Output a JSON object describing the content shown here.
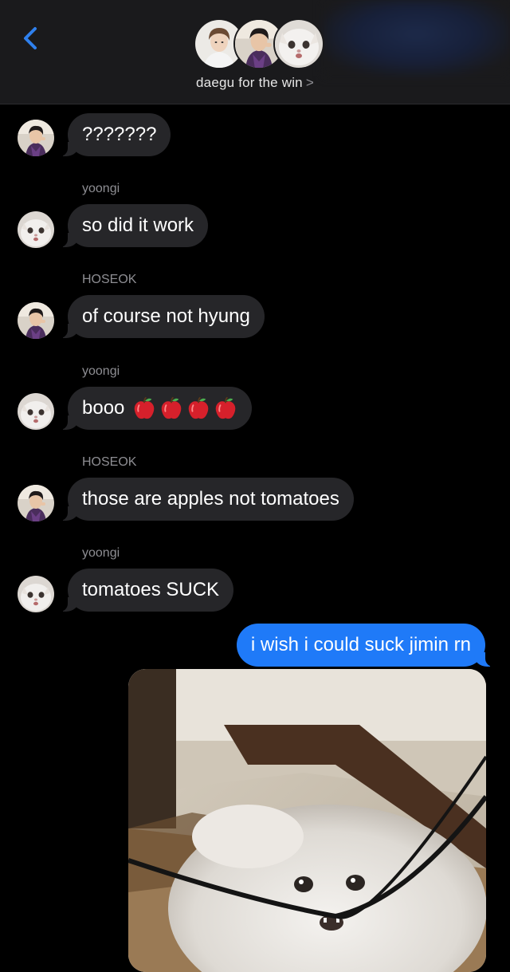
{
  "header": {
    "group_name": "daegu for the win",
    "chevron": ">",
    "back_icon": "chevron-left-icon",
    "accent_color": "#2f80ed"
  },
  "messages": [
    {
      "id": 1,
      "sender": "",
      "text": "???????",
      "avatar": "hoseok"
    },
    {
      "id": 2,
      "sender": "yoongi",
      "text": "so did it work",
      "avatar": "yoongi"
    },
    {
      "id": 3,
      "sender": "HOSEOK",
      "text": "of course not hyung",
      "avatar": "hoseok"
    },
    {
      "id": 4,
      "sender": "yoongi",
      "text": "booo",
      "avatar": "yoongi",
      "emoji": "apple-icon x4"
    },
    {
      "id": 5,
      "sender": "HOSEOK",
      "text": "those are apples not tomatoes",
      "avatar": "hoseok"
    },
    {
      "id": 6,
      "sender": "yoongi",
      "text": "tomatoes SUCK",
      "avatar": "yoongi"
    }
  ],
  "outgoing": {
    "text": "i wish i could suck jimin rn",
    "color": "#1f7af8"
  },
  "photo": {
    "subject": "cat-photo"
  },
  "colors": {
    "incoming_bubble": "#262629",
    "sender_label": "#8e8e93"
  }
}
